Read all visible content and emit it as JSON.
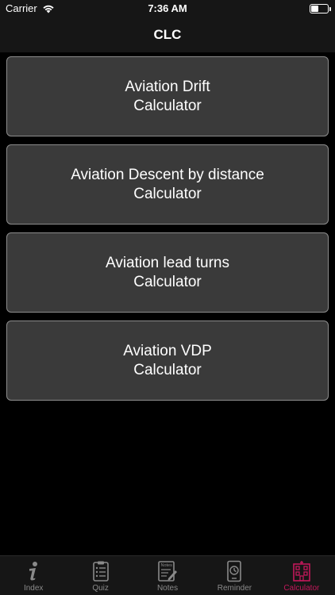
{
  "status_bar": {
    "carrier": "Carrier",
    "time": "7:36 AM",
    "battery_level": 0.45
  },
  "nav": {
    "title": "CLC"
  },
  "buttons": [
    {
      "line1": "Aviation Drift",
      "line2": "Calculator"
    },
    {
      "line1": "Aviation Descent by distance",
      "line2": "Calculator"
    },
    {
      "line1": "Aviation lead turns",
      "line2": "Calculator"
    },
    {
      "line1": "Aviation VDP",
      "line2": "Calculator"
    }
  ],
  "tabs": [
    {
      "label": "Index",
      "icon": "info-icon",
      "active": false
    },
    {
      "label": "Quiz",
      "icon": "clipboard-icon",
      "active": false
    },
    {
      "label": "Notes",
      "icon": "notes-icon",
      "active": false
    },
    {
      "label": "Reminder",
      "icon": "clock-icon",
      "active": false
    },
    {
      "label": "Calculator",
      "icon": "calculator-icon",
      "active": true
    }
  ],
  "notes_icon_text": "Notes",
  "colors": {
    "background": "#000000",
    "bar_background": "#161616",
    "button_background": "#3a3a3a",
    "button_border": "#8c8c8c",
    "tab_inactive": "#8a8a8a",
    "tab_active": "#c2185b"
  }
}
